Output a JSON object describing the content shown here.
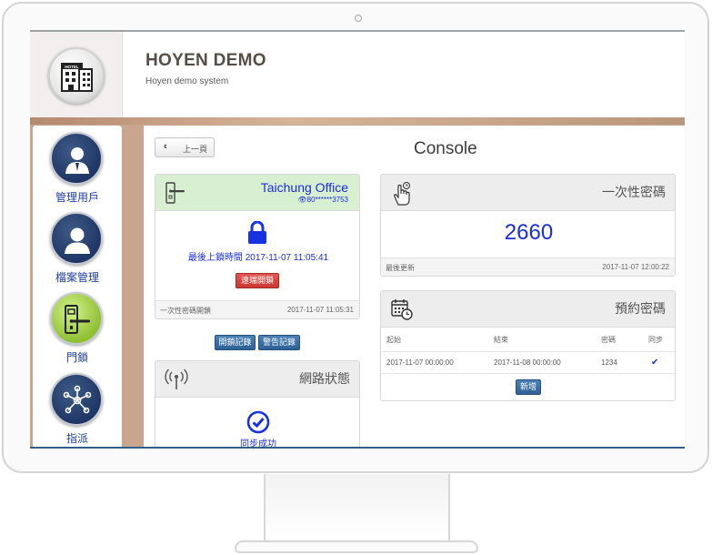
{
  "app": {
    "title": "HOYEN DEMO",
    "subtitle": "Hoyen demo system",
    "logo_text": "HOTEL"
  },
  "sidebar": {
    "items": [
      {
        "label": "管理用戶",
        "icon": "user-icon"
      },
      {
        "label": "檔案管理",
        "icon": "profile-icon"
      },
      {
        "label": "門鎖",
        "icon": "door-lock-icon",
        "active": true
      },
      {
        "label": "指派",
        "icon": "network-icon"
      }
    ]
  },
  "toolbar": {
    "back_label": "上一頁"
  },
  "page": {
    "title": "Console"
  },
  "lock_panel": {
    "office_name": "Taichung Office",
    "device_id": "80******3753",
    "last_lock_label": "最後上鎖時間",
    "last_lock_time": "2017-11-07 11:05:41",
    "remote_unlock_label": "遠端開鎖",
    "footer_left": "一次性密碼開鎖",
    "footer_right": "2017-11-07 11:05:31"
  },
  "record_buttons": {
    "unlock_records": "開鎖記錄",
    "alert_records": "警告記錄"
  },
  "network_panel": {
    "title": "網路狀態",
    "status": "同步成功"
  },
  "otp_panel": {
    "title": "一次性密碼",
    "code": "2660",
    "footer_left": "最後更新",
    "footer_right": "2017-11-07 12:00:22"
  },
  "reservation_panel": {
    "title": "預約密碼",
    "columns": [
      "起始",
      "結束",
      "密碼",
      "同步"
    ],
    "rows": [
      {
        "start": "2017-11-07 00:00:00",
        "end": "2017-11-08 00:00:00",
        "code": "1234",
        "synced": "✔"
      }
    ],
    "add_label": "新增"
  },
  "colors": {
    "accent_blue": "#1a2ed6",
    "lock_blue": "#1533e0",
    "header_green": "#d9efd2",
    "sidebar_circle": "#1f3766",
    "active_circle": "#8fc032",
    "danger": "#c93833",
    "primary_button": "#2e6094"
  }
}
